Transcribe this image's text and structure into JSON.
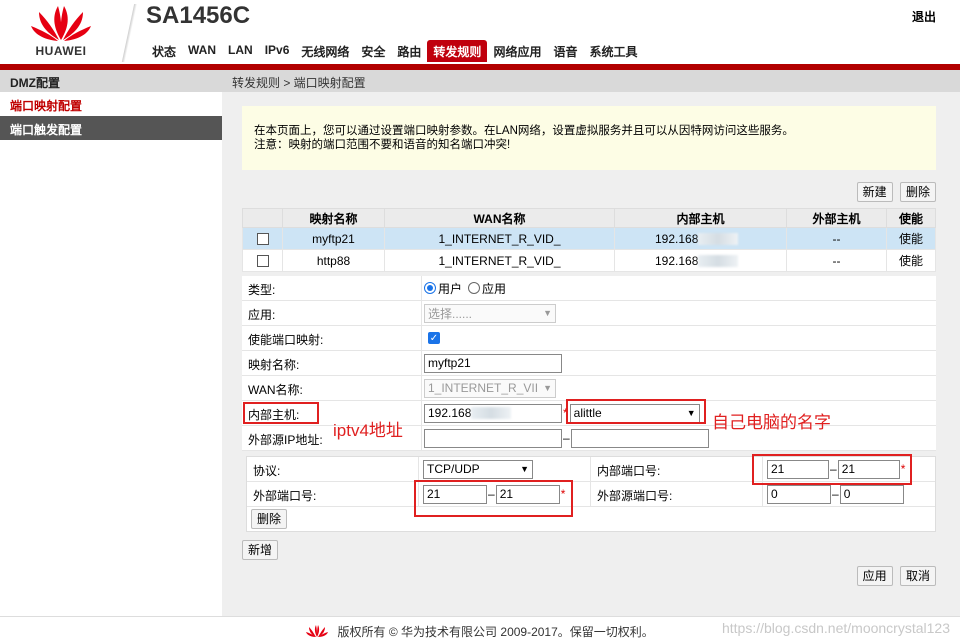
{
  "header": {
    "brand": "HUAWEI",
    "model": "SA1456C",
    "logout": "退出",
    "nav": [
      "状态",
      "WAN",
      "LAN",
      "IPv6",
      "无线网络",
      "安全",
      "路由",
      "转发规则",
      "网络应用",
      "语音",
      "系统工具"
    ],
    "active_nav": "转发规则"
  },
  "sidebar": {
    "title": "DMZ配置",
    "items": [
      "端口映射配置",
      "端口触发配置"
    ]
  },
  "breadcrumb": "转发规则 > 端口映射配置",
  "notice": {
    "line1": "在本页面上，您可以通过设置端口映射参数。在LAN网络，设置虚拟服务并且可以从因特网访问这些服务。",
    "line2": "注意：映射的端口范围不要和语音的知名端口冲突!"
  },
  "buttons": {
    "new": "新建",
    "delete": "删除",
    "apply": "应用",
    "cancel": "取消",
    "sub_delete": "删除",
    "add": "新增"
  },
  "table": {
    "headers": [
      "",
      "映射名称",
      "WAN名称",
      "内部主机",
      "外部主机",
      "使能"
    ],
    "rows": [
      {
        "name": "myftp21",
        "wan": "1_INTERNET_R_VID_",
        "host": "192.168",
        "ext": "--",
        "enable": "使能"
      },
      {
        "name": "http88",
        "wan": "1_INTERNET_R_VID_",
        "host": "192.168",
        "ext": "--",
        "enable": "使能"
      }
    ]
  },
  "form": {
    "type_label": "类型:",
    "type_user": "用户",
    "type_app": "应用",
    "app_label": "应用:",
    "app_placeholder": "选择......",
    "enable_label": "使能端口映射:",
    "name_label": "映射名称:",
    "name_value": "myftp21",
    "wan_label": "WAN名称:",
    "wan_value": "1_INTERNET_R_VII",
    "host_label": "内部主机:",
    "host_value": "192.168",
    "host_select": "alittle",
    "src_label": "外部源IP地址:"
  },
  "sub": {
    "protocol_label": "协议:",
    "protocol_value": "TCP/UDP",
    "inner_port_label": "内部端口号:",
    "inner_port_start": "21",
    "inner_port_end": "21",
    "ext_port_label": "外部端口号:",
    "ext_port_start": "21",
    "ext_port_end": "21",
    "ext_src_port_label": "外部源端口号:",
    "ext_src_start": "0",
    "ext_src_end": "0"
  },
  "annotations": {
    "iptv": "iptv4地址",
    "pc": "自己电脑的名字"
  },
  "footer": {
    "copyright": "版权所有 © 华为技术有限公司 2009-2017。保留一切权利。",
    "watermark": "https://blog.csdn.net/mooncrystal123"
  },
  "colors": {
    "brand_red": "#c0000d",
    "annotation": "#e02020",
    "selected_row": "#cde4f5"
  }
}
